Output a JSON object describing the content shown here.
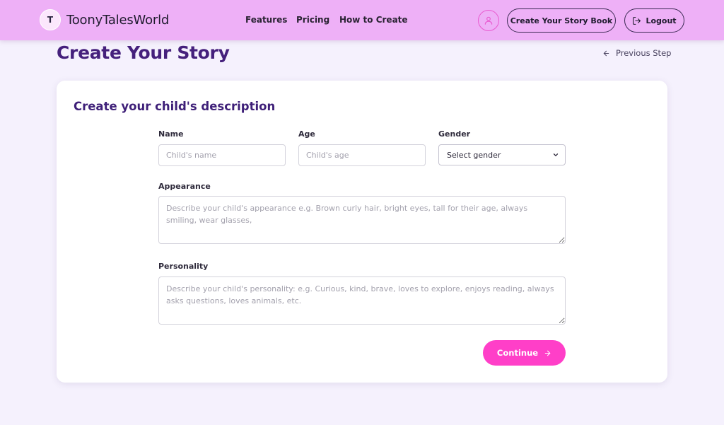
{
  "brand": {
    "initial": "T",
    "name": "ToonyTalesWorld"
  },
  "nav": {
    "links": [
      "Features",
      "Pricing",
      "How to Create"
    ]
  },
  "header": {
    "create_book": "Create Your Story Book",
    "logout": "Logout"
  },
  "page": {
    "title": "Create Your Story",
    "previous_step": "Previous Step"
  },
  "form": {
    "heading": "Create your child's description",
    "name_label": "Name",
    "name_placeholder": "Child's name",
    "age_label": "Age",
    "age_placeholder": "Child's age",
    "gender_label": "Gender",
    "gender_selected": "Select gender",
    "appearance_label": "Appearance",
    "appearance_placeholder": "Describe your child's appearance e.g. Brown curly hair, bright eyes, tall for their age, always smiling, wear glasses,",
    "personality_label": "Personality",
    "personality_placeholder": "Describe your child's personality: e.g. Curious, kind, brave, loves to explore, enjoys reading, always asks questions, loves animals, etc.",
    "continue": "Continue"
  },
  "icons": {
    "profile": "user-icon",
    "logout": "logout-icon",
    "previous": "arrow-left-icon",
    "continue": "arrow-right-icon",
    "select": "chevron-down-icon"
  },
  "colors": {
    "navbar": "#eeb0f7",
    "accent": "#ff3fc8",
    "title": "#45207c",
    "background": "#f5f1fd"
  }
}
